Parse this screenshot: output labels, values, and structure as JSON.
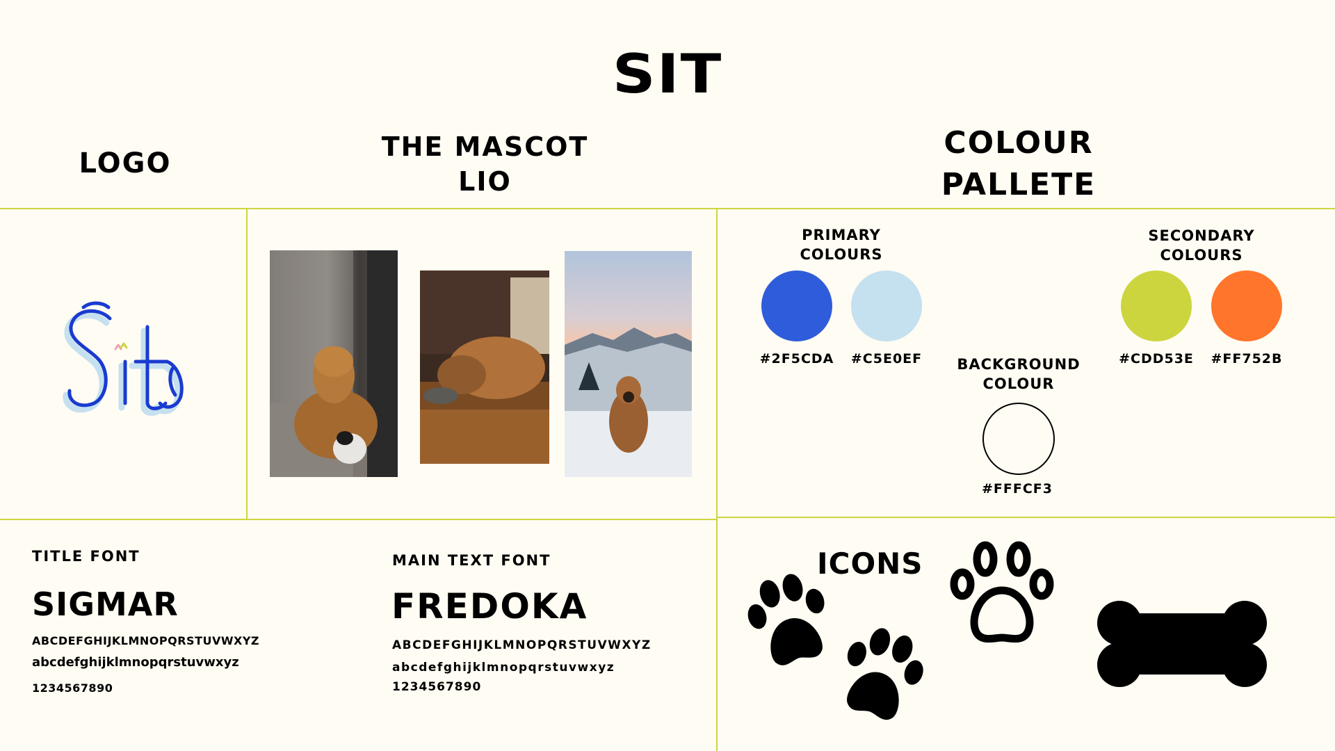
{
  "title": "SIT",
  "sections": {
    "logo": "LOGO",
    "mascot": [
      "THE MASCOT",
      "LIO"
    ],
    "palette": [
      "COLOUR",
      "PALLETE"
    ]
  },
  "logo_text": "Sit",
  "palette": {
    "primary": {
      "heading": [
        "PRIMARY",
        "COLOURS"
      ],
      "colors": [
        {
          "hex": "#2F5CDA",
          "label": "#2F5CDA"
        },
        {
          "hex": "#C5E0EF",
          "label": "#C5E0EF"
        }
      ]
    },
    "secondary": {
      "heading": [
        "SECONDARY",
        "COLOURS"
      ],
      "colors": [
        {
          "hex": "#CDD53E",
          "label": "#CDD53E"
        },
        {
          "hex": "#FF752B",
          "label": "#FF752B"
        }
      ]
    },
    "background": {
      "heading": [
        "BACKGROUND",
        "COLOUR"
      ],
      "color": {
        "hex": "#FFFCF3",
        "label": "#FFFCF3"
      }
    }
  },
  "fonts": {
    "title": {
      "label": "TITLE FONT",
      "name": "SIGMAR",
      "upper": "ABCDEFGHIJKLMNOPQRSTUVWXYZ",
      "lower": "abcdefghijklmnopqrstuvwxyz",
      "digits": "1234567890"
    },
    "main": {
      "label": "MAIN TEXT FONT",
      "name": "FREDOKA",
      "upper": "ABCDEFGHIJKLMNOPQRSTUVWXYZ",
      "lower": "abcdefghijklmnopqrstuvwxyz",
      "digits": "1234567890"
    }
  },
  "icons": {
    "heading": "ICONS",
    "items": [
      "paw-icon",
      "paw-icon",
      "paw-outline-icon",
      "bone-icon"
    ]
  },
  "mascot_photos": [
    "dog-on-bed-photo",
    "dog-sleeping-on-floor-photo",
    "dog-in-snow-mountains-photo"
  ]
}
